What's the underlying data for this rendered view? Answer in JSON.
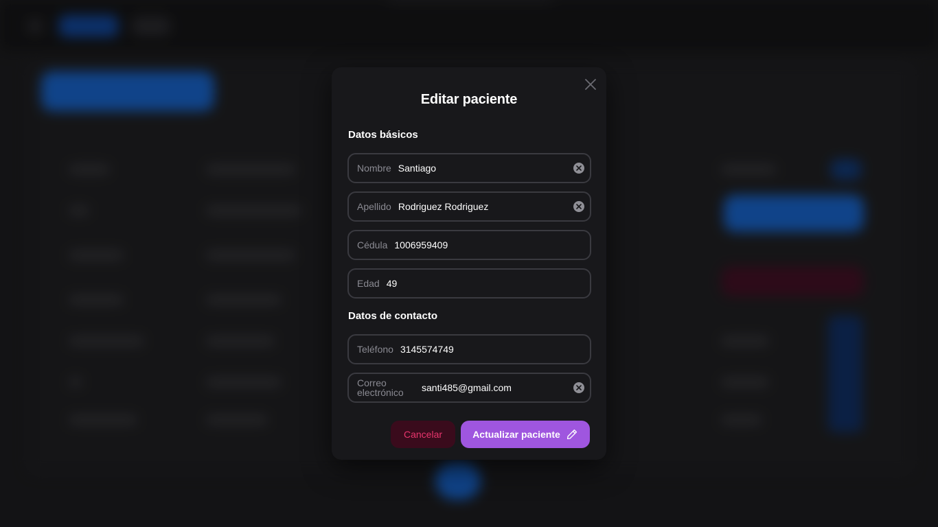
{
  "modal": {
    "title": "Editar paciente",
    "close_icon": "close-icon",
    "sections": {
      "basic": "Datos básicos",
      "contact": "Datos de contacto"
    },
    "fields": {
      "nombre": {
        "label": "Nombre",
        "value": "Santiago"
      },
      "apellido": {
        "label": "Apellido",
        "value": "Rodriguez Rodriguez"
      },
      "cedula": {
        "label": "Cédula",
        "value": "1006959409"
      },
      "edad": {
        "label": "Edad",
        "value": "49"
      },
      "telefono": {
        "label": "Teléfono",
        "value": "3145574749"
      },
      "correo": {
        "label": "Correo electrónico",
        "value": "santi485@gmail.com"
      }
    },
    "buttons": {
      "cancel": "Cancelar",
      "update": "Actualizar paciente",
      "update_icon": "pencil-icon"
    }
  },
  "colors": {
    "modal_bg": "#18181b",
    "field_border": "#3a3a40",
    "cancel_bg": "#3a0b1c",
    "cancel_text": "#e9356d",
    "primary": "#9f56df"
  }
}
